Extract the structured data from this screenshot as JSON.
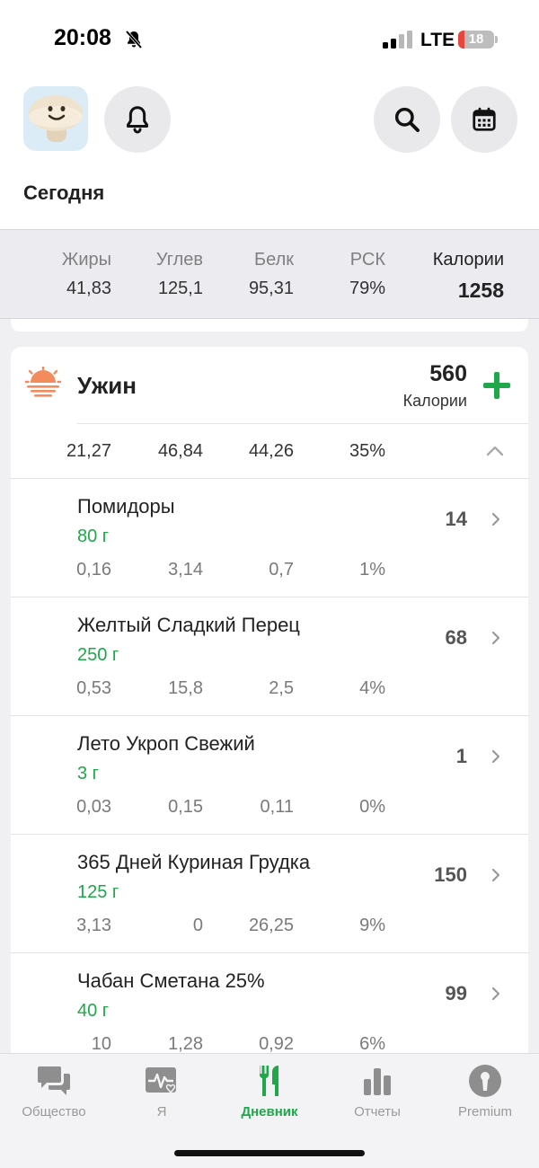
{
  "status_bar": {
    "time": "20:08",
    "network": "LTE",
    "battery_level": "18",
    "battery_fraction": 0.18
  },
  "header": {
    "title": "Сегодня",
    "avatar_icon": "mushroom-avatar-icon",
    "buttons": [
      "bell-icon",
      "search-icon",
      "calendar-icon"
    ]
  },
  "summary": {
    "fat_label": "Жиры",
    "fat": "41,83",
    "carbs_label": "Углев",
    "carbs": "125,1",
    "protein_label": "Белк",
    "protein": "95,31",
    "rsk_label": "РСК",
    "rsk": "79%",
    "cal_label": "Калории",
    "cal": "1258"
  },
  "meal": {
    "name": "Ужин",
    "icon": "sunset-icon",
    "calories": "560",
    "calories_label": "Калории",
    "fat": "21,27",
    "carbs": "46,84",
    "protein": "44,26",
    "rsk": "35%"
  },
  "foods": [
    {
      "name": "Помидоры",
      "amount": "80 г",
      "calories": "14",
      "fat": "0,16",
      "carbs": "3,14",
      "protein": "0,7",
      "rsk": "1%"
    },
    {
      "name": "Желтый Сладкий Перец",
      "amount": "250 г",
      "calories": "68",
      "fat": "0,53",
      "carbs": "15,8",
      "protein": "2,5",
      "rsk": "4%"
    },
    {
      "name": "Лето Укроп Свежий",
      "amount": "3 г",
      "calories": "1",
      "fat": "0,03",
      "carbs": "0,15",
      "protein": "0,11",
      "rsk": "0%"
    },
    {
      "name": "365 Дней Куриная Грудка",
      "amount": "125 г",
      "calories": "150",
      "fat": "3,13",
      "carbs": "0",
      "protein": "26,25",
      "rsk": "9%"
    },
    {
      "name": "Чабан Сметана 25%",
      "amount": "40 г",
      "calories": "99",
      "fat": "10",
      "carbs": "1,28",
      "protein": "0,92",
      "rsk": "6%"
    }
  ],
  "tabs": [
    {
      "label": "Общество",
      "icon": "chat-icon"
    },
    {
      "label": "Я",
      "icon": "health-monitor-icon"
    },
    {
      "label": "Дневник",
      "icon": "fork-knife-icon"
    },
    {
      "label": "Отчеты",
      "icon": "bar-chart-icon"
    },
    {
      "label": "Premium",
      "icon": "premium-icon"
    }
  ],
  "colors": {
    "accent": "#1ea84a",
    "battery_low": "#e8453c",
    "sunset": "#f28c5c"
  }
}
